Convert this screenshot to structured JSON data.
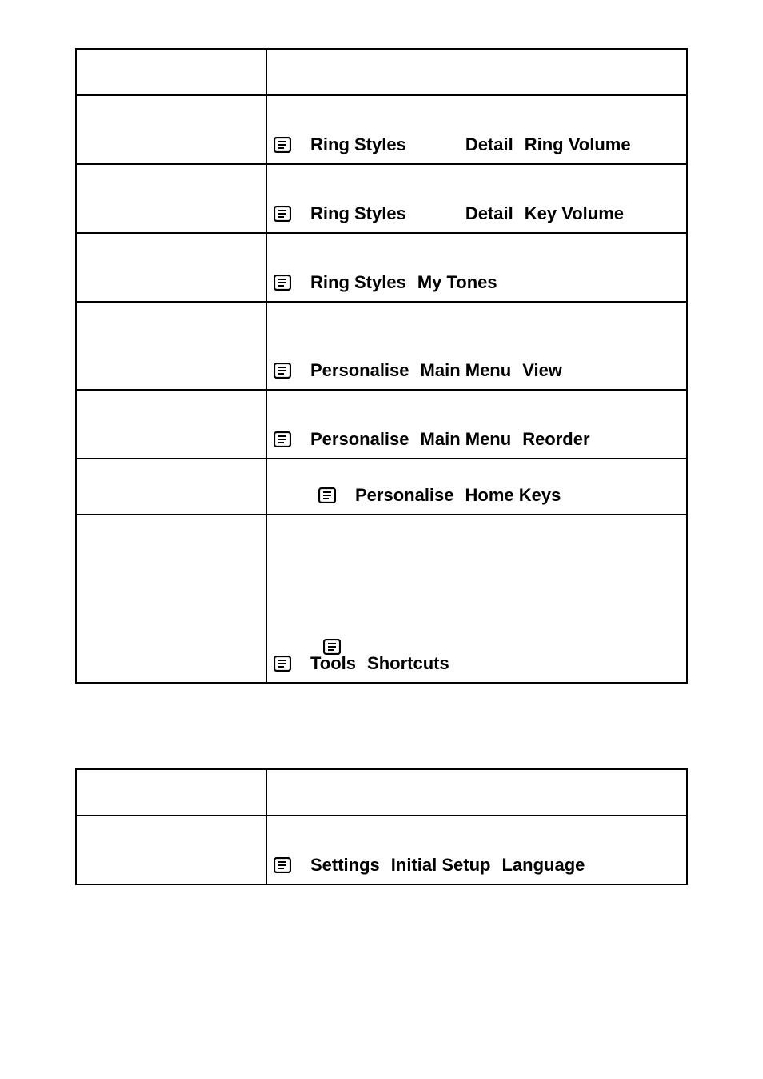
{
  "rows": {
    "r1": {
      "a": "Ring Styles",
      "b": "Detail",
      "c": "Ring Volume"
    },
    "r2": {
      "a": "Ring Styles",
      "b": "Detail",
      "c": "Key Volume"
    },
    "r3": {
      "a": "Ring Styles",
      "b": "My Tones"
    },
    "r4": {
      "a": "Personalise",
      "b": "Main Menu",
      "c": "View"
    },
    "r5": {
      "a": "Personalise",
      "b": "Main Menu",
      "c": "Reorder"
    },
    "r6": {
      "a": "Personalise",
      "b": "Home Keys"
    },
    "r7": {
      "a": "Tools",
      "b": "Shortcuts"
    },
    "lang": {
      "a": "Settings",
      "b": "Initial Setup",
      "c": "Language"
    }
  }
}
